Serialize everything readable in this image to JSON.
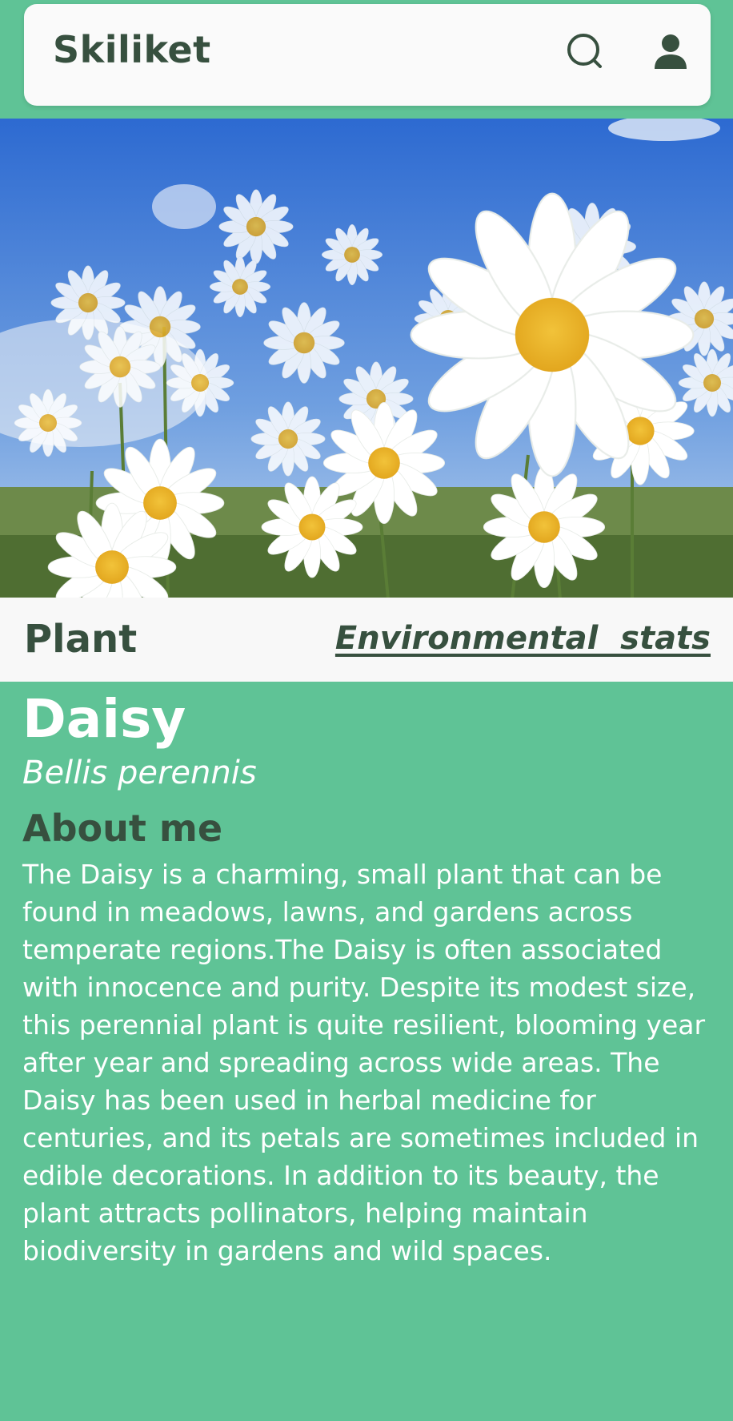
{
  "header": {
    "title": "Skiliket",
    "icons": [
      "search-icon",
      "account-icon"
    ]
  },
  "hero": {
    "image": "daisy-field-photo"
  },
  "tabs": {
    "plant": "Plant",
    "environmental": "Environmental  stats"
  },
  "plant": {
    "name": "Daisy",
    "latin_name": "Bellis perennis",
    "about_heading": "About me",
    "about_text": "The Daisy is a charming, small plant that can be found in meadows, lawns, and gardens across temperate regions.The Daisy is often associated with innocence and purity. Despite its modest size, this perennial plant is quite resilient, blooming year after year and spreading across wide areas. The Daisy has been used in herbal medicine for centuries, and its petals are sometimes included in edible decorations. In addition to its beauty, the plant attracts pollinators, helping maintain biodiversity in gardens and wild spaces."
  },
  "colors": {
    "background": "#5fc396",
    "header_text": "#37503f",
    "bar": "#fafafa"
  }
}
